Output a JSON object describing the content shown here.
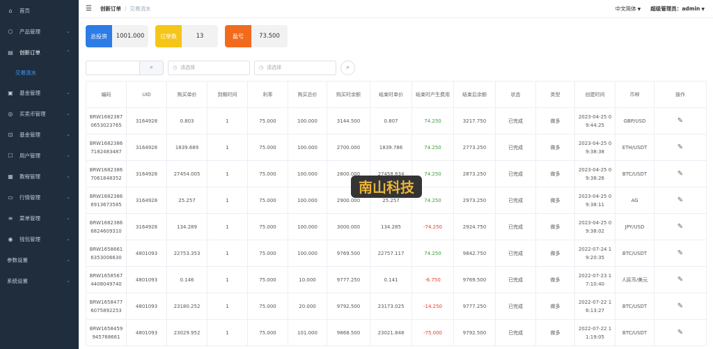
{
  "sidebar": {
    "items": [
      {
        "label": "首页",
        "icon": "home-icon",
        "arrow": false
      },
      {
        "label": "产品管理",
        "icon": "box-icon",
        "arrow": true
      },
      {
        "label": "创新订单",
        "icon": "order-icon",
        "arrow": true,
        "open": true
      },
      {
        "label": "基金管理",
        "icon": "fund-icon",
        "arrow": true
      },
      {
        "label": "买卖币管理",
        "icon": "coin-icon",
        "arrow": true
      },
      {
        "label": "基金管理",
        "icon": "lock-icon",
        "arrow": true
      },
      {
        "label": "用户管理",
        "icon": "user-icon",
        "arrow": true
      },
      {
        "label": "教程管理",
        "icon": "book-icon",
        "arrow": true
      },
      {
        "label": "行情管理",
        "icon": "chart-icon",
        "arrow": true
      },
      {
        "label": "菜单管理",
        "icon": "menu-icon",
        "arrow": true
      },
      {
        "label": "钱包管理",
        "icon": "wallet-icon",
        "arrow": true
      },
      {
        "label": "参数设置",
        "icon": "",
        "arrow": true
      },
      {
        "label": "系统设置",
        "icon": "",
        "arrow": true
      }
    ],
    "sub_active": "交易流水"
  },
  "header": {
    "breadcrumb_1": "创新订单",
    "breadcrumb_sep": "/",
    "breadcrumb_2": "交易流水",
    "language": "中文简体",
    "user": "超级管理员：admin"
  },
  "stats": [
    {
      "label": "总投资",
      "value": "1001.000",
      "color": "#2d7be5"
    },
    {
      "label": "订单数",
      "value": "13",
      "color": "#f5c518"
    },
    {
      "label": "盈亏",
      "value": "73.500",
      "color": "#f26b1d"
    }
  ],
  "filters": {
    "select1_placeholder": "请选择",
    "select2_placeholder": "请选择"
  },
  "table": {
    "headers": [
      "编码",
      "UID",
      "购买单价",
      "到期时间",
      "利率",
      "购买总价",
      "购买时余额",
      "结束时单价",
      "结束时产生费用",
      "结束后余额",
      "状态",
      "类型",
      "创建时间",
      "币种",
      "操作"
    ],
    "rows": [
      {
        "code": "BRW1682387 0653023765",
        "uid": "3164928",
        "price": "0.803",
        "expire": "1",
        "rate": "75.000",
        "total": "100.000",
        "bal_before": "3144.500",
        "end_price": "0.807",
        "fee": "74.250",
        "fee_sign": "pos",
        "bal_after": "3217.750",
        "status": "已完成",
        "type": "做多",
        "created": "2023-04-25 0 9:44:25",
        "currency": "GBP/USD"
      },
      {
        "code": "BRW1682386 7182483487",
        "uid": "3164928",
        "price": "1839.689",
        "expire": "1",
        "rate": "75.000",
        "total": "100.000",
        "bal_before": "2700.000",
        "end_price": "1839.786",
        "fee": "74.250",
        "fee_sign": "pos",
        "bal_after": "2773.250",
        "status": "已完成",
        "type": "做多",
        "created": "2023-04-25 0 9:38:38",
        "currency": "ETH/USDT"
      },
      {
        "code": "BRW1682386 7061848352",
        "uid": "3164928",
        "price": "27454.005",
        "expire": "1",
        "rate": "75.000",
        "total": "100.000",
        "bal_before": "2800.000",
        "end_price": "27458.834",
        "fee": "74.250",
        "fee_sign": "pos",
        "bal_after": "2873.250",
        "status": "已完成",
        "type": "做多",
        "created": "2023-04-25 0 9:38:26",
        "currency": "BTC/USDT"
      },
      {
        "code": "BRW1682386 6913673585",
        "uid": "3164928",
        "price": "25.257",
        "expire": "1",
        "rate": "75.000",
        "total": "100.000",
        "bal_before": "2900.000",
        "end_price": "25.257",
        "fee": "74.250",
        "fee_sign": "pos",
        "bal_after": "2973.250",
        "status": "已完成",
        "type": "做多",
        "created": "2023-04-25 0 9:38:11",
        "currency": "AG"
      },
      {
        "code": "BRW1682386 6824609310",
        "uid": "3164928",
        "price": "134.289",
        "expire": "1",
        "rate": "75.000",
        "total": "100.000",
        "bal_before": "3000.000",
        "end_price": "134.285",
        "fee": "-74.250",
        "fee_sign": "neg",
        "bal_after": "2924.750",
        "status": "已完成",
        "type": "做多",
        "created": "2023-04-25 0 9:38:02",
        "currency": "JPY/USD"
      },
      {
        "code": "BRW1658661 6353006630",
        "uid": "4801093",
        "price": "22753.353",
        "expire": "1",
        "rate": "75.000",
        "total": "100.000",
        "bal_before": "9769.500",
        "end_price": "22757.117",
        "fee": "74.250",
        "fee_sign": "pos",
        "bal_after": "9842.750",
        "status": "已完成",
        "type": "做多",
        "created": "2022-07-24 1 9:20:35",
        "currency": "BTC/USDT"
      },
      {
        "code": "BRW1658567 4408049740",
        "uid": "4801093",
        "price": "0.146",
        "expire": "1",
        "rate": "75.000",
        "total": "10.000",
        "bal_before": "9777.250",
        "end_price": "0.141",
        "fee": "-6.750",
        "fee_sign": "neg",
        "bal_after": "9769.500",
        "status": "已完成",
        "type": "做多",
        "created": "2022-07-23 1 7:10:40",
        "currency": "人民币/美元"
      },
      {
        "code": "BRW1658477 6075892253",
        "uid": "4801093",
        "price": "23180.252",
        "expire": "1",
        "rate": "75.000",
        "total": "20.000",
        "bal_before": "9792.500",
        "end_price": "23173.025",
        "fee": "-14.250",
        "fee_sign": "neg",
        "bal_after": "9777.250",
        "status": "已完成",
        "type": "做多",
        "created": "2022-07-22 1 6:13:27",
        "currency": "BTC/USDT"
      },
      {
        "code": "BRW1658459 945768661",
        "uid": "4801093",
        "price": "23029.952",
        "expire": "1",
        "rate": "75.000",
        "total": "101.000",
        "bal_before": "9868.500",
        "end_price": "23021.848",
        "fee": "-75.000",
        "fee_sign": "neg",
        "bal_after": "9792.500",
        "status": "已完成",
        "type": "做多",
        "created": "2022-07-22 1 1:19:05",
        "currency": "BTC/USDT"
      }
    ]
  },
  "watermark": "南山科技"
}
